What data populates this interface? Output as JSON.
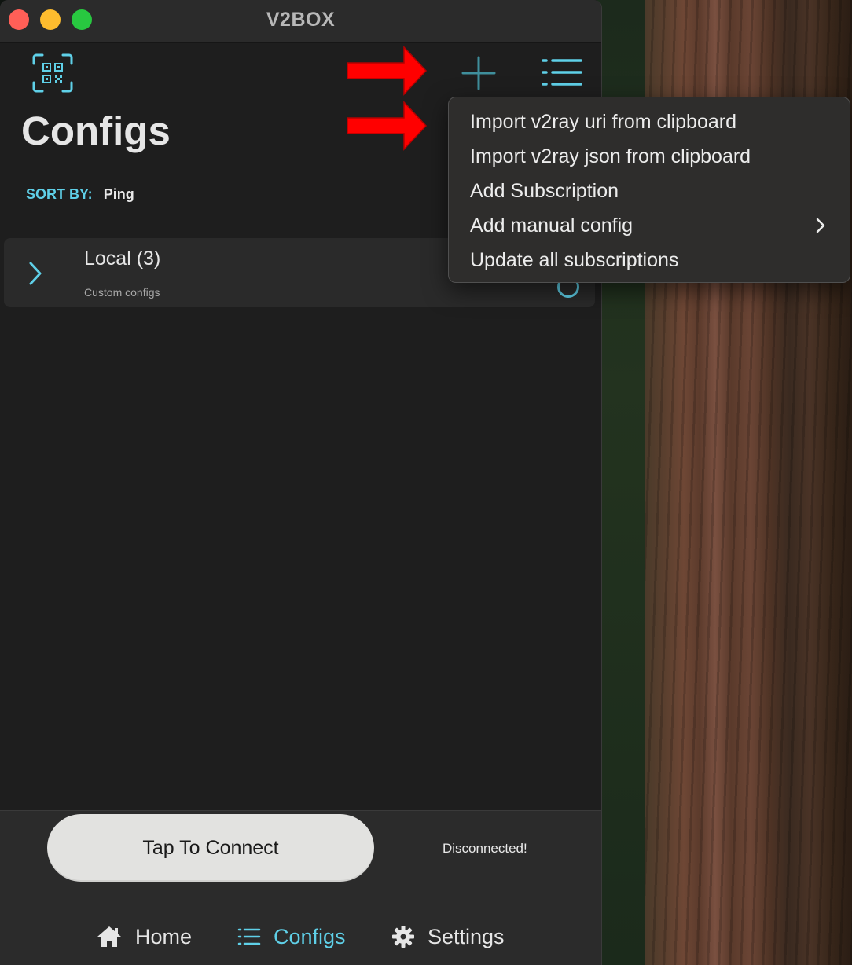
{
  "window": {
    "title": "V2BOX"
  },
  "header": {
    "page_title": "Configs",
    "sort_label": "SORT BY:",
    "sort_value": "Ping"
  },
  "groups": [
    {
      "title": "Local (3)",
      "subtitle": "Custom configs"
    }
  ],
  "menu": {
    "items": [
      {
        "label": "Import v2ray uri from clipboard"
      },
      {
        "label": "Import v2ray json from clipboard"
      },
      {
        "label": "Add Subscription"
      },
      {
        "label": "Add manual config",
        "has_submenu": true
      },
      {
        "label": "Update all subscriptions"
      }
    ]
  },
  "bottom": {
    "connect_label": "Tap To Connect",
    "status": "Disconnected!"
  },
  "nav": {
    "home": "Home",
    "configs": "Configs",
    "settings": "Settings"
  },
  "colors": {
    "accent": "#5fd0e8",
    "background": "#1e1e1e",
    "annotation_arrow": "#ff0000"
  },
  "icons": [
    "qr-scan-icon",
    "plus-icon",
    "list-icon",
    "chevron-right-icon",
    "home-icon",
    "list-icon",
    "gear-icon"
  ]
}
